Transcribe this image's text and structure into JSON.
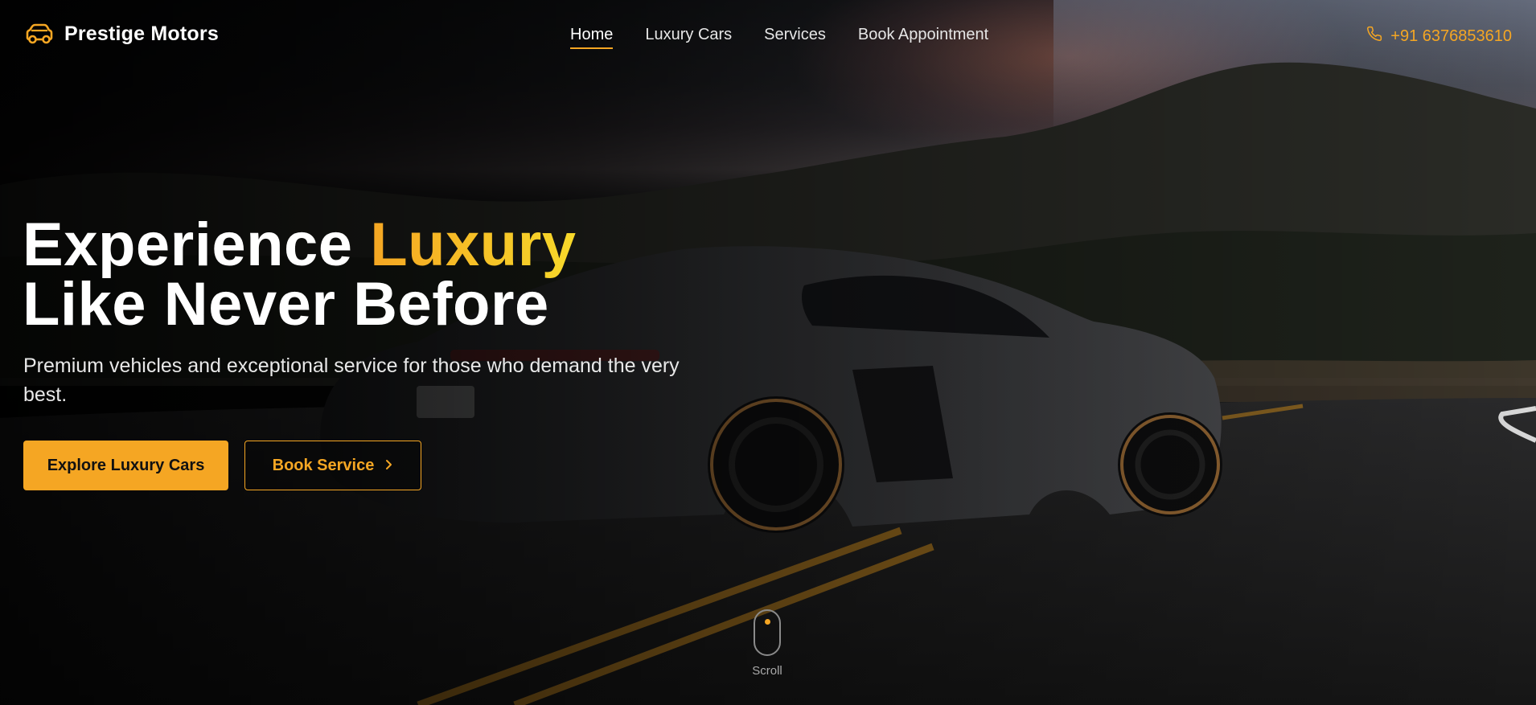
{
  "brand": {
    "name": "Prestige Motors",
    "icon": "car-icon"
  },
  "nav": {
    "links": [
      {
        "label": "Home",
        "active": true
      },
      {
        "label": "Luxury Cars",
        "active": false
      },
      {
        "label": "Services",
        "active": false
      },
      {
        "label": "Book Appointment",
        "active": false
      }
    ],
    "phone": {
      "icon": "phone-icon",
      "number": "+91 6376853610"
    }
  },
  "hero": {
    "headline_line1_prefix": "Experience ",
    "headline_line1_accent": "Luxury",
    "headline_line2": "Like Never Before",
    "subtitle": "Premium vehicles and exceptional service for those who demand the very best.",
    "primary_button": "Explore Luxury Cars",
    "secondary_button": "Book Service",
    "secondary_button_icon": "chevron-right-icon"
  },
  "scroll": {
    "icon": "mouse-icon",
    "label": "Scroll"
  },
  "colors": {
    "accent": "#f5a623",
    "accent_gradient_end": "#f7d92a",
    "text": "#ffffff"
  }
}
